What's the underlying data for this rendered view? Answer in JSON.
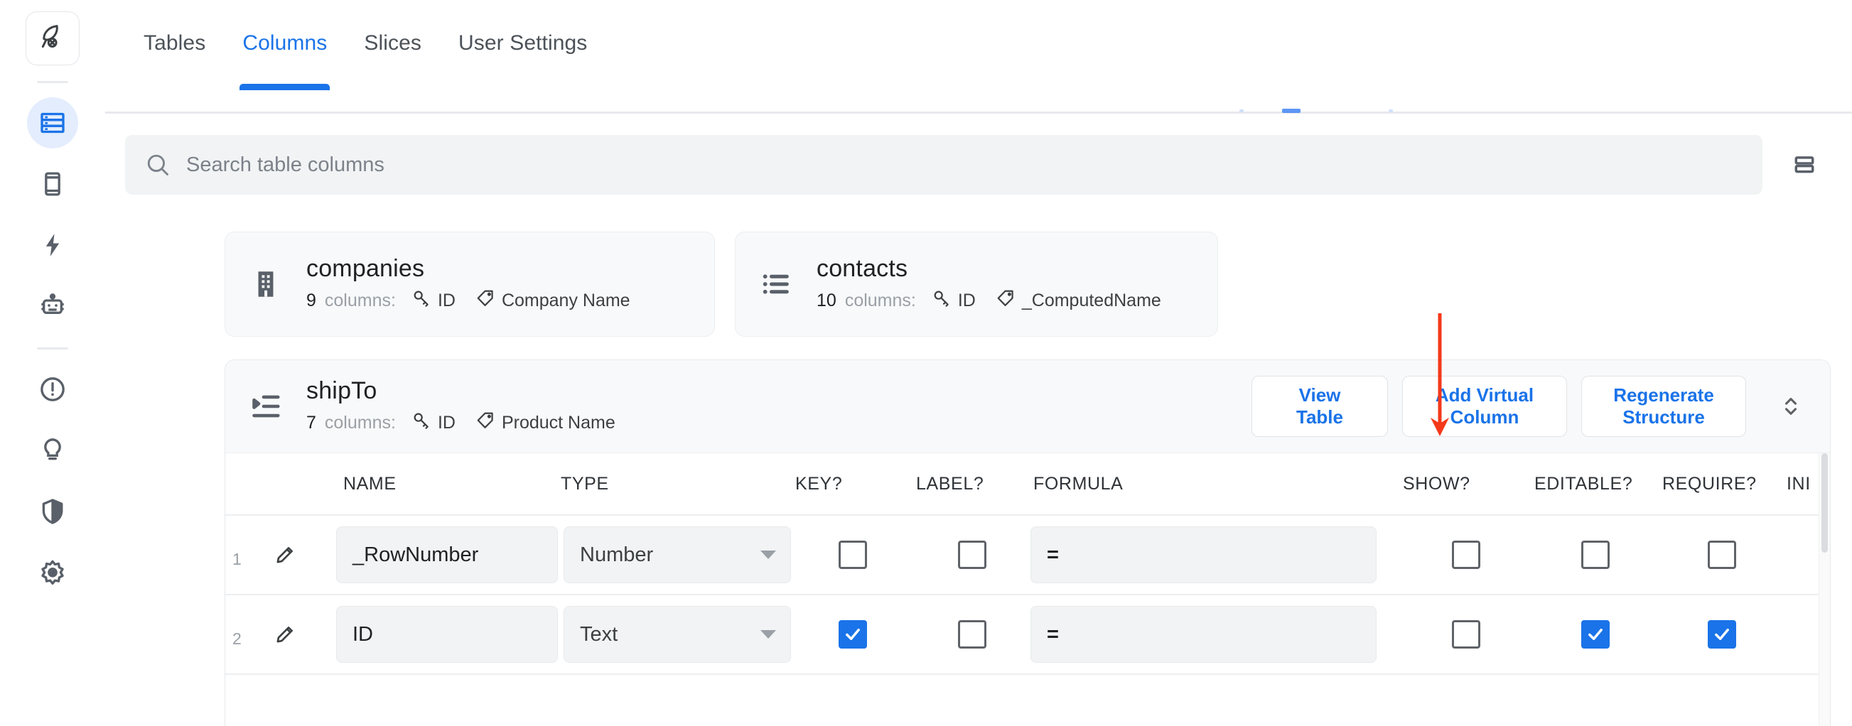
{
  "app": {
    "logo_icon": "rocket-icon"
  },
  "rail": {
    "items": [
      {
        "icon": "database-table-icon",
        "active": true
      },
      {
        "icon": "mobile-device-icon",
        "active": false
      },
      {
        "icon": "lightning-bolt-icon",
        "active": false
      },
      {
        "icon": "robot-icon",
        "active": false
      },
      {
        "icon": "error-circle-icon",
        "active": false
      },
      {
        "icon": "lightbulb-icon",
        "active": false
      },
      {
        "icon": "shield-icon",
        "active": false
      },
      {
        "icon": "gear-icon",
        "active": false
      }
    ]
  },
  "tabs": [
    {
      "label": "Tables",
      "active": false
    },
    {
      "label": "Columns",
      "active": true
    },
    {
      "label": "Slices",
      "active": false
    },
    {
      "label": "User Settings",
      "active": false
    }
  ],
  "search": {
    "placeholder": "Search table columns",
    "value": "",
    "icon": "search-icon"
  },
  "layout_toggle": {
    "icon": "split-view-icon"
  },
  "tables": [
    {
      "name": "companies",
      "icon": "building-icon",
      "column_count": "9",
      "columns_label": "columns:",
      "key_column": "ID",
      "label_column": "Company Name"
    },
    {
      "name": "contacts",
      "icon": "list-icon",
      "column_count": "10",
      "columns_label": "columns:",
      "key_column": "ID",
      "label_column": "_ComputedName"
    }
  ],
  "expanded_table": {
    "name": "shipTo",
    "icon": "indent-list-icon",
    "column_count": "7",
    "columns_label": "columns:",
    "key_column": "ID",
    "label_column": "Product Name",
    "buttons": [
      {
        "label": "View\nTable",
        "name": "view-table-button"
      },
      {
        "label": "Add Virtual\nColumn",
        "name": "add-virtual-column-button"
      },
      {
        "label": "Regenerate\nStructure",
        "name": "regenerate-structure-button"
      }
    ],
    "collapse_icon": "expand-collapse-chevron-icon",
    "grid": {
      "headers": [
        "NAME",
        "TYPE",
        "KEY?",
        "LABEL?",
        "FORMULA",
        "SHOW?",
        "EDITABLE?",
        "REQUIRE?",
        "INI"
      ],
      "rows": [
        {
          "index": "1",
          "edit_icon": "pencil-icon",
          "name": "_RowNumber",
          "type": "Number",
          "key": false,
          "label": false,
          "formula": "=",
          "show": false,
          "editable": false,
          "require": false,
          "initial": "="
        },
        {
          "index": "2",
          "edit_icon": "pencil-icon",
          "name": "ID",
          "type": "Text",
          "key": true,
          "label": false,
          "formula": "=",
          "show": false,
          "editable": true,
          "require": true,
          "initial": "="
        }
      ]
    }
  },
  "annotation": {
    "type": "arrow",
    "color": "#f4381a",
    "points_to": "add-virtual-column-button"
  },
  "colors": {
    "accent": "#1a73e8",
    "tab_active": "#1a73e8",
    "annotation": "#f4381a",
    "field_bg": "#f1f3f4",
    "panel_bg": "#f8f9fa"
  }
}
